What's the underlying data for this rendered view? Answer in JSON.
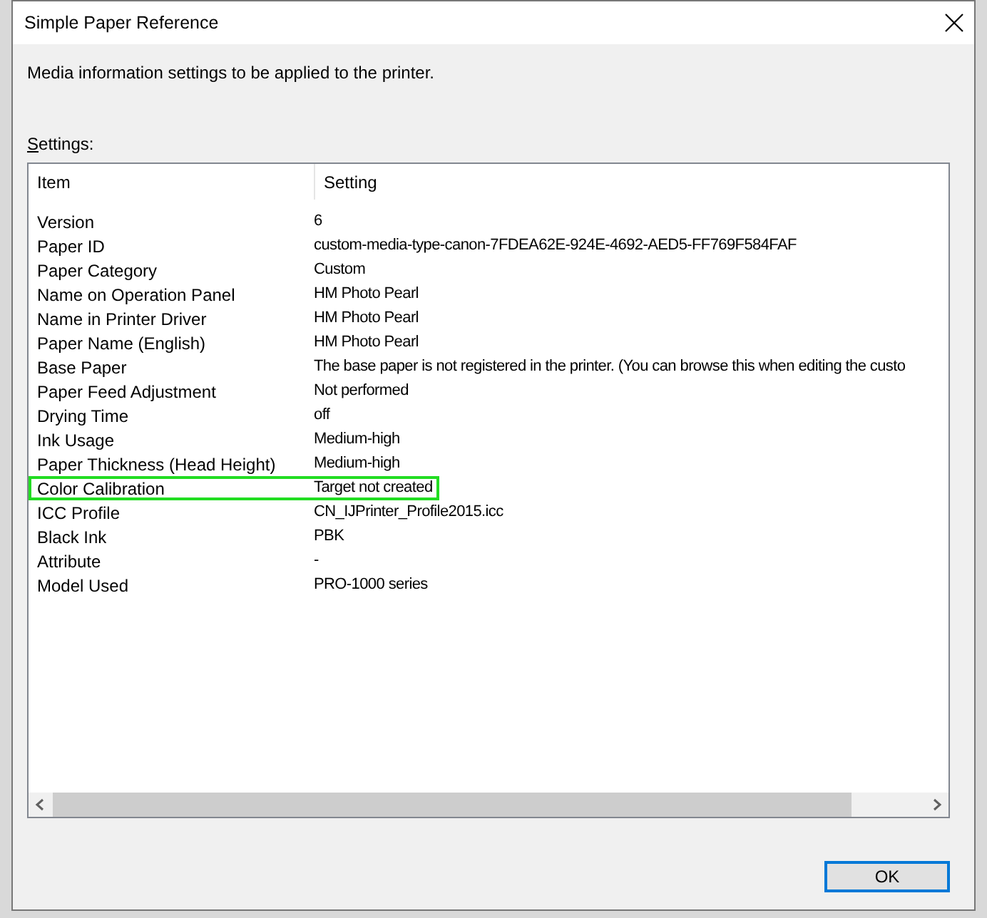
{
  "window": {
    "title": "Simple Paper Reference"
  },
  "description": "Media information settings to be applied to the printer.",
  "list_label": "Settings:",
  "table": {
    "columns": [
      "Item",
      "Setting"
    ],
    "rows": [
      {
        "item": "Version",
        "setting": "6",
        "highlighted": false
      },
      {
        "item": "Paper ID",
        "setting": "custom-media-type-canon-7FDEA62E-924E-4692-AED5-FF769F584FAF",
        "highlighted": false
      },
      {
        "item": "Paper Category",
        "setting": "Custom",
        "highlighted": false
      },
      {
        "item": "Name on Operation Panel",
        "setting": "HM Photo Pearl",
        "highlighted": false
      },
      {
        "item": "Name in Printer Driver",
        "setting": "HM Photo Pearl",
        "highlighted": false
      },
      {
        "item": "Paper Name (English)",
        "setting": "HM Photo Pearl",
        "highlighted": false
      },
      {
        "item": "Base Paper",
        "setting": "The base paper is not registered in the printer. (You can browse this when editing the custo",
        "highlighted": false
      },
      {
        "item": "Paper Feed Adjustment",
        "setting": "Not performed",
        "highlighted": false
      },
      {
        "item": "Drying Time",
        "setting": "off",
        "highlighted": false
      },
      {
        "item": "Ink Usage",
        "setting": "Medium-high",
        "highlighted": false
      },
      {
        "item": "Paper Thickness (Head Height)",
        "setting": "Medium-high",
        "highlighted": false
      },
      {
        "item": "Color Calibration",
        "setting": "Target not created",
        "highlighted": true
      },
      {
        "item": "ICC Profile",
        "setting": "CN_IJPrinter_Profile2015.icc",
        "highlighted": false
      },
      {
        "item": "Black Ink",
        "setting": "PBK",
        "highlighted": false
      },
      {
        "item": "Attribute",
        "setting": "-",
        "highlighted": false
      },
      {
        "item": "Model Used",
        "setting": "PRO-1000 series",
        "highlighted": false
      }
    ]
  },
  "buttons": [
    {
      "label": "OK",
      "default": true
    }
  ]
}
